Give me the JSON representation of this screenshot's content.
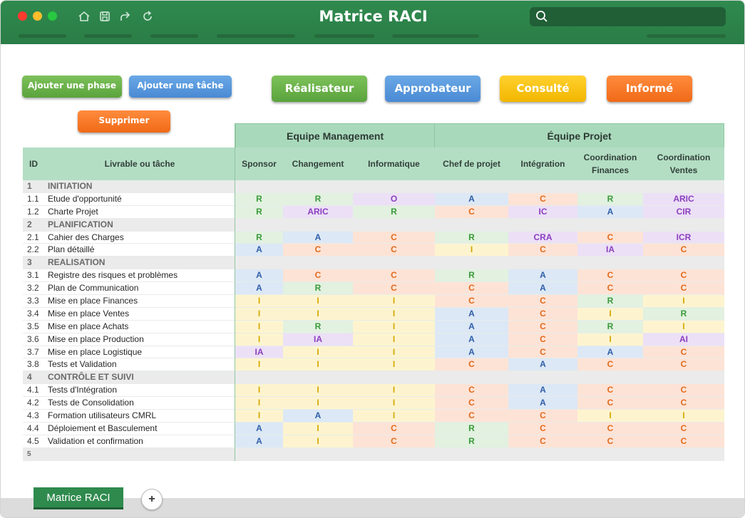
{
  "app": {
    "title": "Matrice RACI"
  },
  "colors": {
    "R": "#3a9a3a",
    "A": "#2f5ea8",
    "C": "#e16a1c",
    "I": "#d4a800",
    "O": "#8b3fbf",
    "header_green": "#2f8a4e"
  },
  "toolbar": {
    "add_phase": "Ajouter une phase",
    "add_task": "Ajouter une tâche",
    "delete": "Supprimer",
    "realisateur": "Réalisateur",
    "approbateur": "Approbateur",
    "consulte": "Consulté",
    "informe": "Informé"
  },
  "groups": [
    {
      "label": "Equipe Management"
    },
    {
      "label": "Équipe Projet"
    }
  ],
  "headers": {
    "id": "ID",
    "task": "Livrable ou tâche",
    "roles": [
      "Sponsor",
      "Changement",
      "Informatique",
      "Chef de projet",
      "Intégration",
      "Coordination\nFinances",
      "Coordination\nVentes"
    ]
  },
  "rows": [
    {
      "type": "phase",
      "id": "1",
      "label": "INITIATION"
    },
    {
      "type": "task",
      "id": "1.1",
      "label": "Etude d'opportunité",
      "cells": [
        "R",
        "R",
        "O",
        "A",
        "C",
        "R",
        "ARIC"
      ]
    },
    {
      "type": "task",
      "id": "1.2",
      "label": "Charte Projet",
      "cells": [
        "R",
        "ARIC",
        "R",
        "C",
        "IC",
        "A",
        "CIR"
      ]
    },
    {
      "type": "phase",
      "id": "2",
      "label": "PLANIFICATION"
    },
    {
      "type": "task",
      "id": "2.1",
      "label": "Cahier des Charges",
      "cells": [
        "R",
        "A",
        "C",
        "R",
        "CRA",
        "C",
        "ICR"
      ]
    },
    {
      "type": "task",
      "id": "2.2",
      "label": "Plan détaillé",
      "cells": [
        "A",
        "C",
        "C",
        "I",
        "C",
        "IA",
        "C"
      ]
    },
    {
      "type": "phase",
      "id": "3",
      "label": "REALISATION"
    },
    {
      "type": "task",
      "id": "3.1",
      "label": "Registre des risques et problèmes",
      "cells": [
        "A",
        "C",
        "C",
        "R",
        "A",
        "C",
        "C"
      ]
    },
    {
      "type": "task",
      "id": "3.2",
      "label": "Plan de Communication",
      "cells": [
        "A",
        "R",
        "C",
        "C",
        "A",
        "C",
        "C"
      ]
    },
    {
      "type": "task",
      "id": "3.3",
      "label": "Mise en place Finances",
      "cells": [
        "I",
        "I",
        "I",
        "C",
        "C",
        "R",
        "I"
      ]
    },
    {
      "type": "task",
      "id": "3.4",
      "label": "Mise en place Ventes",
      "cells": [
        "I",
        "I",
        "I",
        "A",
        "C",
        "I",
        "R"
      ]
    },
    {
      "type": "task",
      "id": "3.5",
      "label": "Mise en place Achats",
      "cells": [
        "I",
        "R",
        "I",
        "A",
        "C",
        "R",
        "I"
      ]
    },
    {
      "type": "task",
      "id": "3.6",
      "label": "Mise en place Production",
      "cells": [
        "I",
        "IA",
        "I",
        "A",
        "C",
        "I",
        "AI"
      ]
    },
    {
      "type": "task",
      "id": "3.7",
      "label": "Mise en place Logistique",
      "cells": [
        "IA",
        "I",
        "I",
        "A",
        "C",
        "A",
        "C"
      ]
    },
    {
      "type": "task",
      "id": "3.8",
      "label": "Tests et Validation",
      "cells": [
        "I",
        "I",
        "I",
        "C",
        "A",
        "C",
        "C"
      ]
    },
    {
      "type": "phase",
      "id": "4",
      "label": "CONTRÔLE ET SUIVI"
    },
    {
      "type": "task",
      "id": "4.1",
      "label": "Tests d'Intégration",
      "cells": [
        "I",
        "I",
        "I",
        "C",
        "A",
        "C",
        "C"
      ]
    },
    {
      "type": "task",
      "id": "4.2",
      "label": "Tests de Consolidation",
      "cells": [
        "I",
        "I",
        "I",
        "C",
        "A",
        "C",
        "C"
      ]
    },
    {
      "type": "task",
      "id": "4.3",
      "label": "Formation utilisateurs CMRL",
      "cells": [
        "I",
        "A",
        "I",
        "C",
        "C",
        "I",
        "I"
      ]
    },
    {
      "type": "task",
      "id": "4.4",
      "label": "Déploiement et Basculement",
      "cells": [
        "A",
        "I",
        "C",
        "R",
        "C",
        "C",
        "C"
      ]
    },
    {
      "type": "task",
      "id": "4.5",
      "label": "Validation et confirmation",
      "cells": [
        "A",
        "I",
        "C",
        "R",
        "C",
        "C",
        "C"
      ]
    },
    {
      "type": "phase",
      "id": "5",
      "label": ""
    }
  ],
  "sheet": {
    "tab_label": "Matrice RACI",
    "add_label": "+"
  }
}
